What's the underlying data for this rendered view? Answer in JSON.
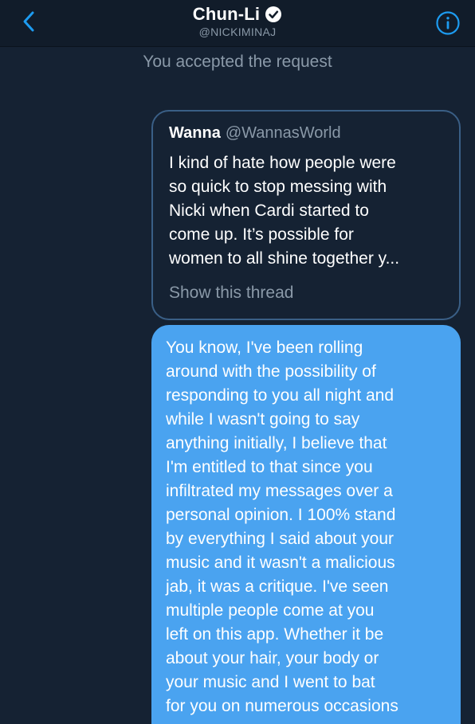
{
  "header": {
    "title": "Chun-Li",
    "handle": "@NICKIMINAJ",
    "back_icon": "chevron-left-icon",
    "info_icon": "info-icon",
    "verified_icon": "verified-badge-icon",
    "accent_color": "#1d9bf0"
  },
  "conversation": {
    "system_message": "You accepted the request",
    "quoted_tweet": {
      "name": "Wanna",
      "handle": "@WannasWorld",
      "text": "I kind of hate how people were\nso quick to stop messing with\nNicki when Cardi started to\ncome up. It’s possible for\nwomen to all shine together y...",
      "show_thread_label": "Show this thread"
    },
    "message": {
      "text": "You know, I've been rolling\naround with the possibility of\nresponding to you all night and\nwhile I wasn't going to say\nanything initially, I believe that\nI'm entitled to that since you\ninfiltrated my messages over a\npersonal opinion. I 100% stand\nby everything I said about your\nmusic and it wasn't a malicious\njab, it was a critique. I've seen\nmultiple people come at you\nleft on this app. Whether it be\nabout your hair, your body or\nyour music and I went to bat\nfor you on numerous occasions",
      "bubble_color": "#4aa3f0"
    }
  }
}
